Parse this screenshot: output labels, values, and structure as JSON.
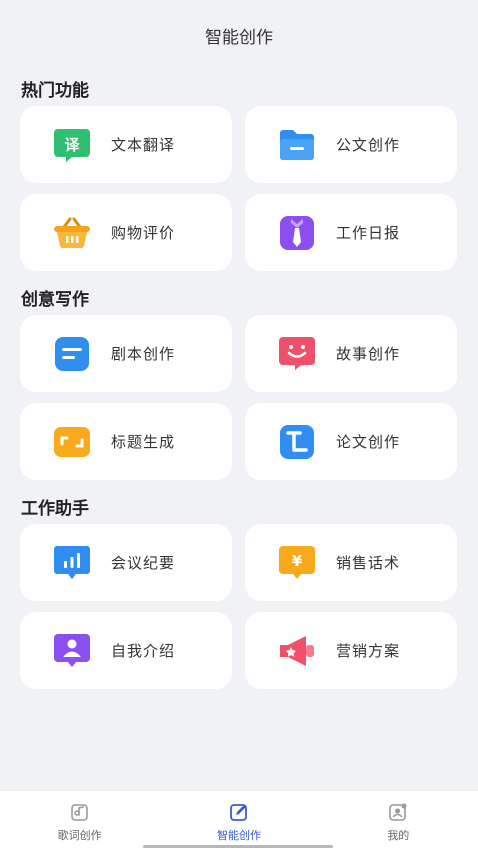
{
  "header": {
    "title": "智能创作"
  },
  "sections": [
    {
      "title": "热门功能",
      "items": [
        {
          "label": "文本翻译",
          "icon": "translate-icon"
        },
        {
          "label": "公文创作",
          "icon": "folder-icon"
        },
        {
          "label": "购物评价",
          "icon": "basket-icon"
        },
        {
          "label": "工作日报",
          "icon": "tie-icon"
        }
      ]
    },
    {
      "title": "创意写作",
      "items": [
        {
          "label": "剧本创作",
          "icon": "script-icon"
        },
        {
          "label": "故事创作",
          "icon": "smile-icon"
        },
        {
          "label": "标题生成",
          "icon": "title-frame-icon"
        },
        {
          "label": "论文创作",
          "icon": "paper-icon"
        }
      ]
    },
    {
      "title": "工作助手",
      "items": [
        {
          "label": "会议纪要",
          "icon": "bar-chart-icon"
        },
        {
          "label": "销售话术",
          "icon": "yen-icon"
        },
        {
          "label": "自我介绍",
          "icon": "person-icon"
        },
        {
          "label": "营销方案",
          "icon": "megaphone-icon"
        }
      ]
    }
  ],
  "tabbar": {
    "items": [
      {
        "label": "歌词创作",
        "icon": "music-edit-icon",
        "active": false
      },
      {
        "label": "智能创作",
        "icon": "edit-icon",
        "active": true
      },
      {
        "label": "我的",
        "icon": "profile-icon",
        "active": false
      }
    ]
  },
  "colors": {
    "accent": "#3a5bd9",
    "background": "#f1f2f6",
    "translate": "#2fbf71",
    "folder": "#2f8ef0",
    "basket": "#f6a31b",
    "tie": "#8b4ff0",
    "script": "#2f8ef0",
    "smile": "#f0506a",
    "title_frame": "#f8a91c",
    "paper": "#2f8ef0",
    "bar_chart": "#2f8ef0",
    "yen": "#f8a91c",
    "person": "#8b4ff0",
    "megaphone": "#f0506a"
  }
}
